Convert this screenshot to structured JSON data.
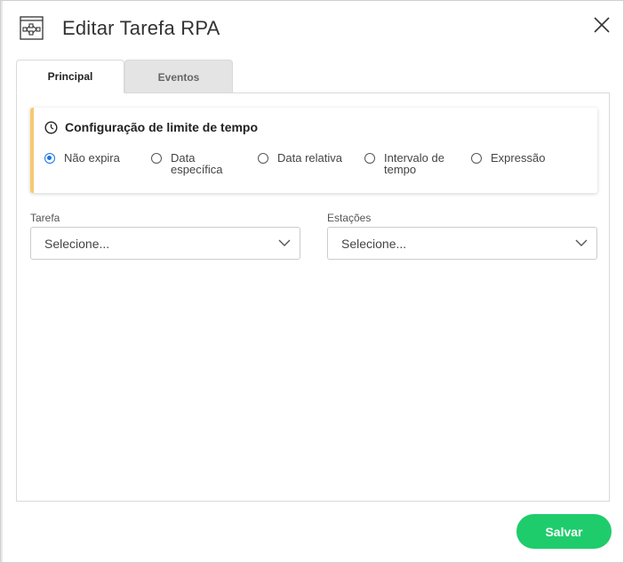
{
  "header": {
    "title": "Editar Tarefa RPA",
    "icon": "rpa-workflow-icon",
    "close_icon": "close-icon"
  },
  "tabs": [
    {
      "label": "Principal",
      "active": true
    },
    {
      "label": "Eventos",
      "active": false
    }
  ],
  "timeout": {
    "title": "Configuração de limite de tempo",
    "icon": "clock-icon",
    "accent_color": "#f7c873",
    "options": [
      {
        "label": "Não expira",
        "checked": true
      },
      {
        "label": "Data específica",
        "checked": false
      },
      {
        "label": "Data relativa",
        "checked": false
      },
      {
        "label": "Intervalo de tempo",
        "checked": false
      },
      {
        "label": "Expressão",
        "checked": false
      }
    ]
  },
  "fields": {
    "tarefa": {
      "label": "Tarefa",
      "value": "Selecione..."
    },
    "estacoes": {
      "label": "Estações",
      "value": "Selecione..."
    }
  },
  "footer": {
    "save_label": "Salvar",
    "save_color": "#1fcc6c"
  }
}
